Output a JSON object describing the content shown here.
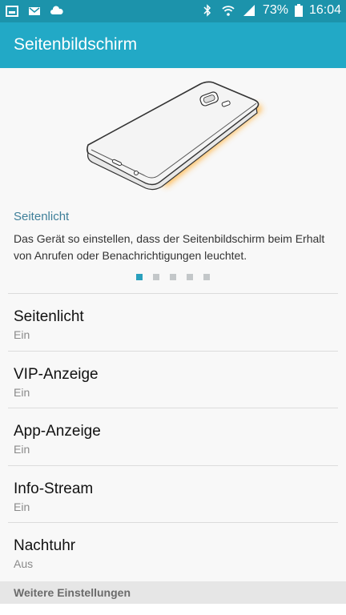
{
  "status_bar": {
    "left_icons": [
      "gallery-icon",
      "mail-icon",
      "cloud-icon"
    ],
    "right_icons": [
      "bluetooth-icon",
      "wifi-icon",
      "signal-icon"
    ],
    "battery": "73%",
    "time": "16:04"
  },
  "appbar": {
    "title": "Seitenbildschirm"
  },
  "feature": {
    "title": "Seitenlicht",
    "description": "Das Gerät so einstellen, dass der Seitenbildschirm beim Erhalt von Anrufen oder Benachrichtigungen leuchtet.",
    "page_count": 5,
    "active_page": 1
  },
  "settings": [
    {
      "label": "Seitenlicht",
      "value": "Ein"
    },
    {
      "label": "VIP-Anzeige",
      "value": "Ein"
    },
    {
      "label": "App-Anzeige",
      "value": "Ein"
    },
    {
      "label": "Info-Stream",
      "value": "Ein"
    },
    {
      "label": "Nachtuhr",
      "value": "Aus"
    }
  ],
  "section_header": "Weitere Einstellungen",
  "colors": {
    "status_bar": "#1c93ab",
    "app_bar": "#22a9c6",
    "accent_text": "#3e7f99",
    "glow": "#ffb340"
  }
}
